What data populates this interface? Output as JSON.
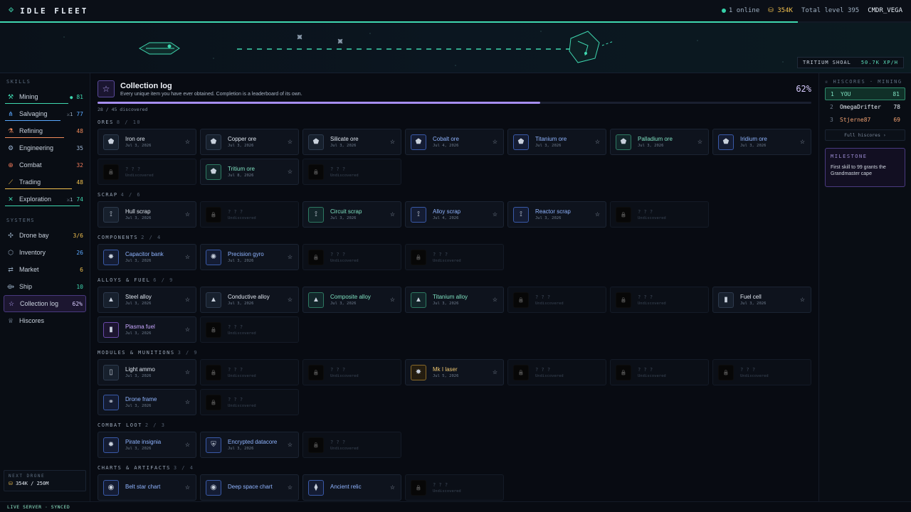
{
  "topbar": {
    "title": "IDLE FLEET",
    "online": "1 online",
    "credits": "354K",
    "total_level": "Total level 395",
    "user": "CMDR_VEGA",
    "progress": 0.876
  },
  "banner": {
    "location": "TRITIUM SHOAL",
    "rate": "50.7K XP/H"
  },
  "sidebar": {
    "skills_label": "SKILLS",
    "skills": [
      {
        "name": "Mining",
        "icon": "pickaxe-icon",
        "glyph": "⚒",
        "level": "81",
        "badge": "●",
        "color": "#3fd8b0",
        "xp": 0.8
      },
      {
        "name": "Salvaging",
        "icon": "salvage-icon",
        "glyph": "⋔",
        "level": "77",
        "badge": "⚔1",
        "color": "#5aa8ff",
        "xp": 0.7
      },
      {
        "name": "Refining",
        "icon": "flask-icon",
        "glyph": "⚗",
        "level": "48",
        "badge": "",
        "color": "#f08a5a",
        "xp": 0.75
      },
      {
        "name": "Engineering",
        "icon": "gear-icon",
        "glyph": "⚙",
        "level": "35",
        "badge": "",
        "color": "#9fb8d8",
        "xp": 0
      },
      {
        "name": "Combat",
        "icon": "crosshair-icon",
        "glyph": "⊕",
        "level": "32",
        "badge": "",
        "color": "#f07a5a",
        "xp": 0
      },
      {
        "name": "Trading",
        "icon": "chart-icon",
        "glyph": "⟋",
        "level": "48",
        "badge": "",
        "color": "#f2c14e",
        "xp": 0.85
      },
      {
        "name": "Exploration",
        "icon": "compass-icon",
        "glyph": "✕",
        "level": "74",
        "badge": "⚔1",
        "color": "#3fd8b0",
        "xp": 0.95
      }
    ],
    "systems_label": "SYSTEMS",
    "systems": [
      {
        "name": "Drone bay",
        "icon": "drone-icon",
        "glyph": "✣",
        "count": "3/6",
        "color": "#f2c14e"
      },
      {
        "name": "Inventory",
        "icon": "box-icon",
        "glyph": "⬡",
        "count": "26",
        "color": "#5aa8ff"
      },
      {
        "name": "Market",
        "icon": "swap-icon",
        "glyph": "⇄",
        "count": "6",
        "color": "#f2c14e"
      },
      {
        "name": "Ship",
        "icon": "ship-icon",
        "glyph": "⟴",
        "count": "10",
        "color": "#3fd8b0"
      },
      {
        "name": "Collection log",
        "icon": "star-icon",
        "glyph": "☆",
        "count": "62%",
        "color": "#d8ccff"
      },
      {
        "name": "Hiscores",
        "icon": "trophy-icon",
        "glyph": "♕",
        "count": "",
        "color": "#c9d2de"
      }
    ],
    "next_drone_label": "NEXT DRONE",
    "next_drone_value": "354K / 250M"
  },
  "collection": {
    "title": "Collection log",
    "subtitle": "Every unique item you have ever obtained. Completion is a leaderboard of its own.",
    "percent": "62%",
    "progress": 0.62,
    "discovered": "28 / 45 discovered",
    "categories": [
      {
        "name": "ORES",
        "count": "8 / 10",
        "items": [
          {
            "name": "Iron ore",
            "date": "Jul 3, 2026",
            "glyph": "⬟",
            "tone": ""
          },
          {
            "name": "Copper ore",
            "date": "Jul 3, 2026",
            "glyph": "⬟",
            "tone": ""
          },
          {
            "name": "Silicate ore",
            "date": "Jul 3, 2026",
            "glyph": "⬟",
            "tone": ""
          },
          {
            "name": "Cobalt ore",
            "date": "Jul 4, 2026",
            "glyph": "⬟",
            "tone": "c-blue"
          },
          {
            "name": "Titanium ore",
            "date": "Jul 3, 2026",
            "glyph": "⬟",
            "tone": "c-blue"
          },
          {
            "name": "Palladium ore",
            "date": "Jul 3, 2026",
            "glyph": "⬟",
            "tone": "c-green"
          },
          {
            "name": "Iridium ore",
            "date": "Jul 3, 2026",
            "glyph": "⬟",
            "tone": "c-blue"
          },
          {
            "locked": true
          },
          {
            "name": "Tritium ore",
            "date": "Jul 8, 2026",
            "glyph": "⬟",
            "tone": "c-green"
          },
          {
            "locked": true
          }
        ]
      },
      {
        "name": "SCRAP",
        "count": "4 / 6",
        "items": [
          {
            "name": "Hull scrap",
            "date": "Jul 3, 2026",
            "glyph": "⟟",
            "tone": ""
          },
          {
            "locked": true
          },
          {
            "name": "Circuit scrap",
            "date": "Jul 3, 2026",
            "glyph": "⟟",
            "tone": "c-green"
          },
          {
            "name": "Alloy scrap",
            "date": "Jul 4, 2026",
            "glyph": "⟟",
            "tone": "c-blue"
          },
          {
            "name": "Reactor scrap",
            "date": "Jul 3, 2026",
            "glyph": "⟟",
            "tone": "c-blue"
          },
          {
            "locked": true
          }
        ]
      },
      {
        "name": "COMPONENTS",
        "count": "2 / 4",
        "items": [
          {
            "name": "Capacitor bank",
            "date": "Jul 3, 2026",
            "glyph": "✸",
            "tone": "c-blue"
          },
          {
            "name": "Precision gyro",
            "date": "Jul 3, 2026",
            "glyph": "✺",
            "tone": "c-blue"
          },
          {
            "locked": true
          },
          {
            "locked": true
          }
        ]
      },
      {
        "name": "ALLOYS & FUEL",
        "count": "6 / 9",
        "items": [
          {
            "name": "Steel alloy",
            "date": "Jul 3, 2026",
            "glyph": "▲",
            "tone": ""
          },
          {
            "name": "Conductive alloy",
            "date": "Jul 3, 2026",
            "glyph": "▲",
            "tone": ""
          },
          {
            "name": "Composite alloy",
            "date": "Jul 3, 2026",
            "glyph": "▲",
            "tone": "c-green"
          },
          {
            "name": "Titanium alloy",
            "date": "Jul 3, 2026",
            "glyph": "▲",
            "tone": "c-green"
          },
          {
            "locked": true
          },
          {
            "locked": true
          },
          {
            "name": "Fuel cell",
            "date": "Jul 3, 2026",
            "glyph": "▮",
            "tone": ""
          },
          {
            "name": "Plasma fuel",
            "date": "Jul 3, 2026",
            "glyph": "▮",
            "tone": "c-violet"
          },
          {
            "locked": true
          }
        ]
      },
      {
        "name": "MODULES & MUNITIONS",
        "count": "3 / 9",
        "items": [
          {
            "name": "Light ammo",
            "date": "Jul 3, 2026",
            "glyph": "▯",
            "tone": ""
          },
          {
            "locked": true
          },
          {
            "locked": true
          },
          {
            "name": "Mk I laser",
            "date": "Jul 5, 2026",
            "glyph": "✸",
            "tone": "c-gold"
          },
          {
            "locked": true
          },
          {
            "locked": true
          },
          {
            "locked": true
          },
          {
            "name": "Drone frame",
            "date": "Jul 3, 2026",
            "glyph": "⚭",
            "tone": "c-blue"
          },
          {
            "locked": true
          }
        ]
      },
      {
        "name": "COMBAT LOOT",
        "count": "2 / 3",
        "items": [
          {
            "name": "Pirate insignia",
            "date": "Jul 3, 2026",
            "glyph": "✹",
            "tone": "c-blue"
          },
          {
            "name": "Encrypted datacore",
            "date": "Jul 3, 2026",
            "glyph": "⛨",
            "tone": "c-blue"
          },
          {
            "locked": true
          }
        ]
      },
      {
        "name": "CHARTS & ARTIFACTS",
        "count": "3 / 4",
        "items": [
          {
            "name": "Belt star chart",
            "date": "",
            "glyph": "◉",
            "tone": "c-blue"
          },
          {
            "name": "Deep space chart",
            "date": "",
            "glyph": "◉",
            "tone": "c-blue"
          },
          {
            "name": "Ancient relic",
            "date": "",
            "glyph": "⧫",
            "tone": "c-blue"
          },
          {
            "locked": true
          }
        ]
      }
    ],
    "locked_name": "? ? ?",
    "locked_sub": "Undiscovered"
  },
  "hiscores": {
    "label": "HISCORES · MINING",
    "rows": [
      {
        "rank": "1",
        "name": "YOU",
        "score": "81",
        "me": true
      },
      {
        "rank": "2",
        "name": "OmegaDrifter",
        "score": "78",
        "me": false,
        "color": "#e6edf5"
      },
      {
        "rank": "3",
        "name": "Stjerne87",
        "score": "69",
        "me": false,
        "color": "#f0a070"
      }
    ],
    "full": "Full hiscores ›"
  },
  "milestone": {
    "label": "MILESTONE",
    "text": "First skill to 99 grants the Grandmaster cape"
  },
  "footer": {
    "status": "LIVE SERVER · SYNCED"
  }
}
